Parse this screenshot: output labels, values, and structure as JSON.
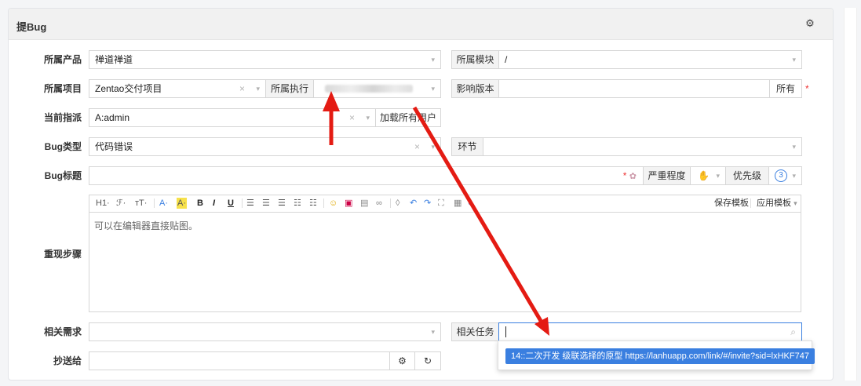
{
  "panel": {
    "title": "提Bug"
  },
  "form": {
    "product_label": "所属产品",
    "product_value": "禅道禅道",
    "module_label": "所属模块",
    "module_value": "/",
    "project_label": "所属项目",
    "project_value": "Zentao交付项目",
    "execution_label": "所属执行",
    "build_label": "影响版本",
    "build_all": "所有",
    "assign_label": "当前指派",
    "assign_value": "A:admin",
    "load_all_users": "加载所有用户",
    "type_label": "Bug类型",
    "type_value": "代码错误",
    "env_label": "环节",
    "title_label": "Bug标题",
    "severity_label": "严重程度",
    "severity_icon": "✋",
    "priority_label": "优先级",
    "priority_value": "3",
    "steps_label": "重现步骤",
    "steps_placeholder": "可以在编辑器直接贴图。",
    "save_template": "保存模板",
    "apply_template": "应用模板",
    "story_label": "相关需求",
    "task_label": "相关任务",
    "mailto_label": "抄送给"
  },
  "toolbar": {
    "h1": "H1·",
    "font": "ℱ·",
    "size": "тT·",
    "color": "A·",
    "bg": "A·",
    "bold": "B",
    "italic": "I",
    "underline": "U"
  },
  "dropdown": {
    "item": "14::二次开发 级联选择的原型 https://lanhuapp.com/link/#/invite?sid=lxHKF747"
  },
  "colors": {
    "accent": "#3a7fe0",
    "arrow": "#e41b13",
    "required": "#e33333"
  }
}
